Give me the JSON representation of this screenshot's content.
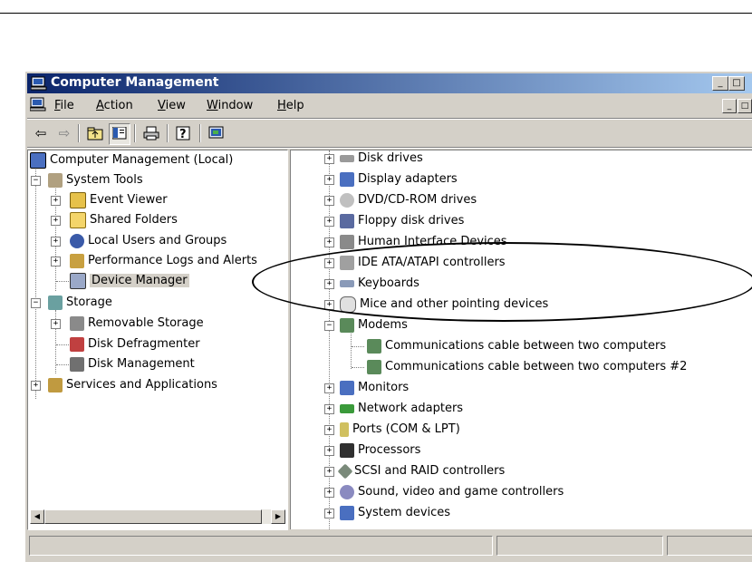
{
  "window": {
    "title": "Computer Management",
    "mdi_buttons": [
      "_",
      "□"
    ]
  },
  "menu": {
    "file": {
      "key": "F",
      "rest": "ile"
    },
    "action": {
      "key": "A",
      "rest": "ction"
    },
    "view": {
      "key": "V",
      "rest": "iew"
    },
    "window": {
      "key": "W",
      "rest": "indow"
    },
    "help": {
      "key": "H",
      "rest": "elp"
    }
  },
  "toolbar": {
    "icons": [
      "back-arrow-icon",
      "forward-arrow-icon",
      "up-folder-icon",
      "show-hide-tree-icon",
      "print-icon",
      "help-icon",
      "properties-icon"
    ]
  },
  "left_tree": {
    "root": "Computer Management (Local)",
    "system_tools": "System Tools",
    "event_viewer": "Event Viewer",
    "shared_folders": "Shared Folders",
    "local_users": "Local Users and Groups",
    "perf_logs": "Performance Logs and Alerts",
    "device_manager": "Device Manager",
    "storage": "Storage",
    "removable_storage": "Removable Storage",
    "disk_defrag": "Disk Defragmenter",
    "disk_mgmt": "Disk Management",
    "services": "Services and Applications"
  },
  "right_tree": {
    "disk_drives": "Disk drives",
    "display_adapters": "Display adapters",
    "dvd": "DVD/CD-ROM drives",
    "floppy": "Floppy disk drives",
    "hid": "Human Interface Devices",
    "ide": "IDE ATA/ATAPI controllers",
    "keyboards": "Keyboards",
    "mice": "Mice and other pointing devices",
    "modems": "Modems",
    "comm1": "Communications cable between two computers",
    "comm2": "Communications cable between two computers #2",
    "monitors": "Monitors",
    "network": "Network adapters",
    "ports": "Ports (COM & LPT)",
    "processors": "Processors",
    "scsi": "SCSI and RAID controllers",
    "sound": "Sound, video and game controllers",
    "system": "System devices"
  },
  "colors": {
    "title_start": "#0a246a",
    "title_end": "#a6caf0",
    "chrome": "#d4d0c8"
  }
}
